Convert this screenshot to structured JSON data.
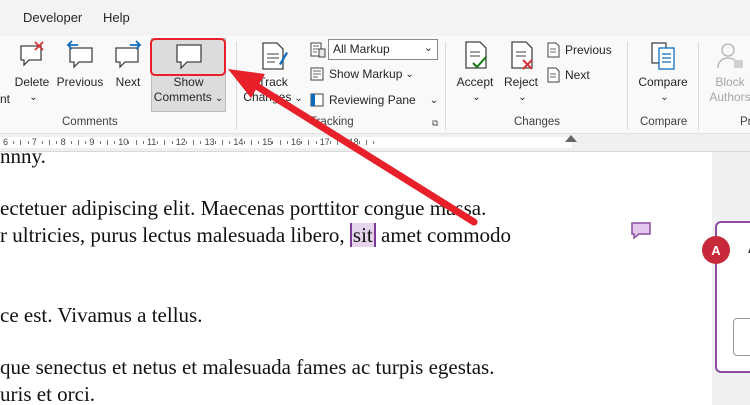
{
  "menu": {
    "developer": "Developer",
    "help": "Help"
  },
  "ribbon": {
    "left_fragment": "nt",
    "delete": "Delete",
    "previous": "Previous",
    "next": "Next",
    "show_comments_line1": "Show",
    "show_comments_line2": "Comments",
    "comments_group": "Comments",
    "track_changes_line1": "Track",
    "track_changes_line2": "Changes",
    "markup_dropdown": "All Markup",
    "show_markup": "Show Markup",
    "reviewing_pane": "Reviewing Pane",
    "tracking_group": "Tracking",
    "accept": "Accept",
    "reject": "Reject",
    "prev_change": "Previous",
    "next_change": "Next",
    "changes_group": "Changes",
    "compare": "Compare",
    "compare_group": "Compare",
    "block_line1": "Block",
    "block_line2": "Authors",
    "protect_group": "Pr"
  },
  "ruler": {
    "numbers": [
      "6",
      "7",
      "8",
      "9",
      "10",
      "11",
      "12",
      "13",
      "14",
      "15",
      "16",
      "17",
      "18"
    ]
  },
  "document": {
    "line0": "nnny.",
    "line1": "ectetuer adipiscing elit. Maecenas porttitor congue massa.",
    "line2_pre": "r ultricies, purus lectus malesuada libero, ",
    "line2_hl": "sit",
    "line2_post": " amet commodo",
    "line3": "ce est. Vivamus a tellus.",
    "line4": "que senectus et netus et malesuada fames ac turpis egestas.",
    "line5": "uris et orci."
  },
  "comment": {
    "author_initial": "A",
    "text_fragment": "A"
  },
  "colors": {
    "highlight_box": "#e8202a",
    "arrow": "#e8202a",
    "comment_accent": "#8c4d9e",
    "avatar": "#c7293b"
  }
}
